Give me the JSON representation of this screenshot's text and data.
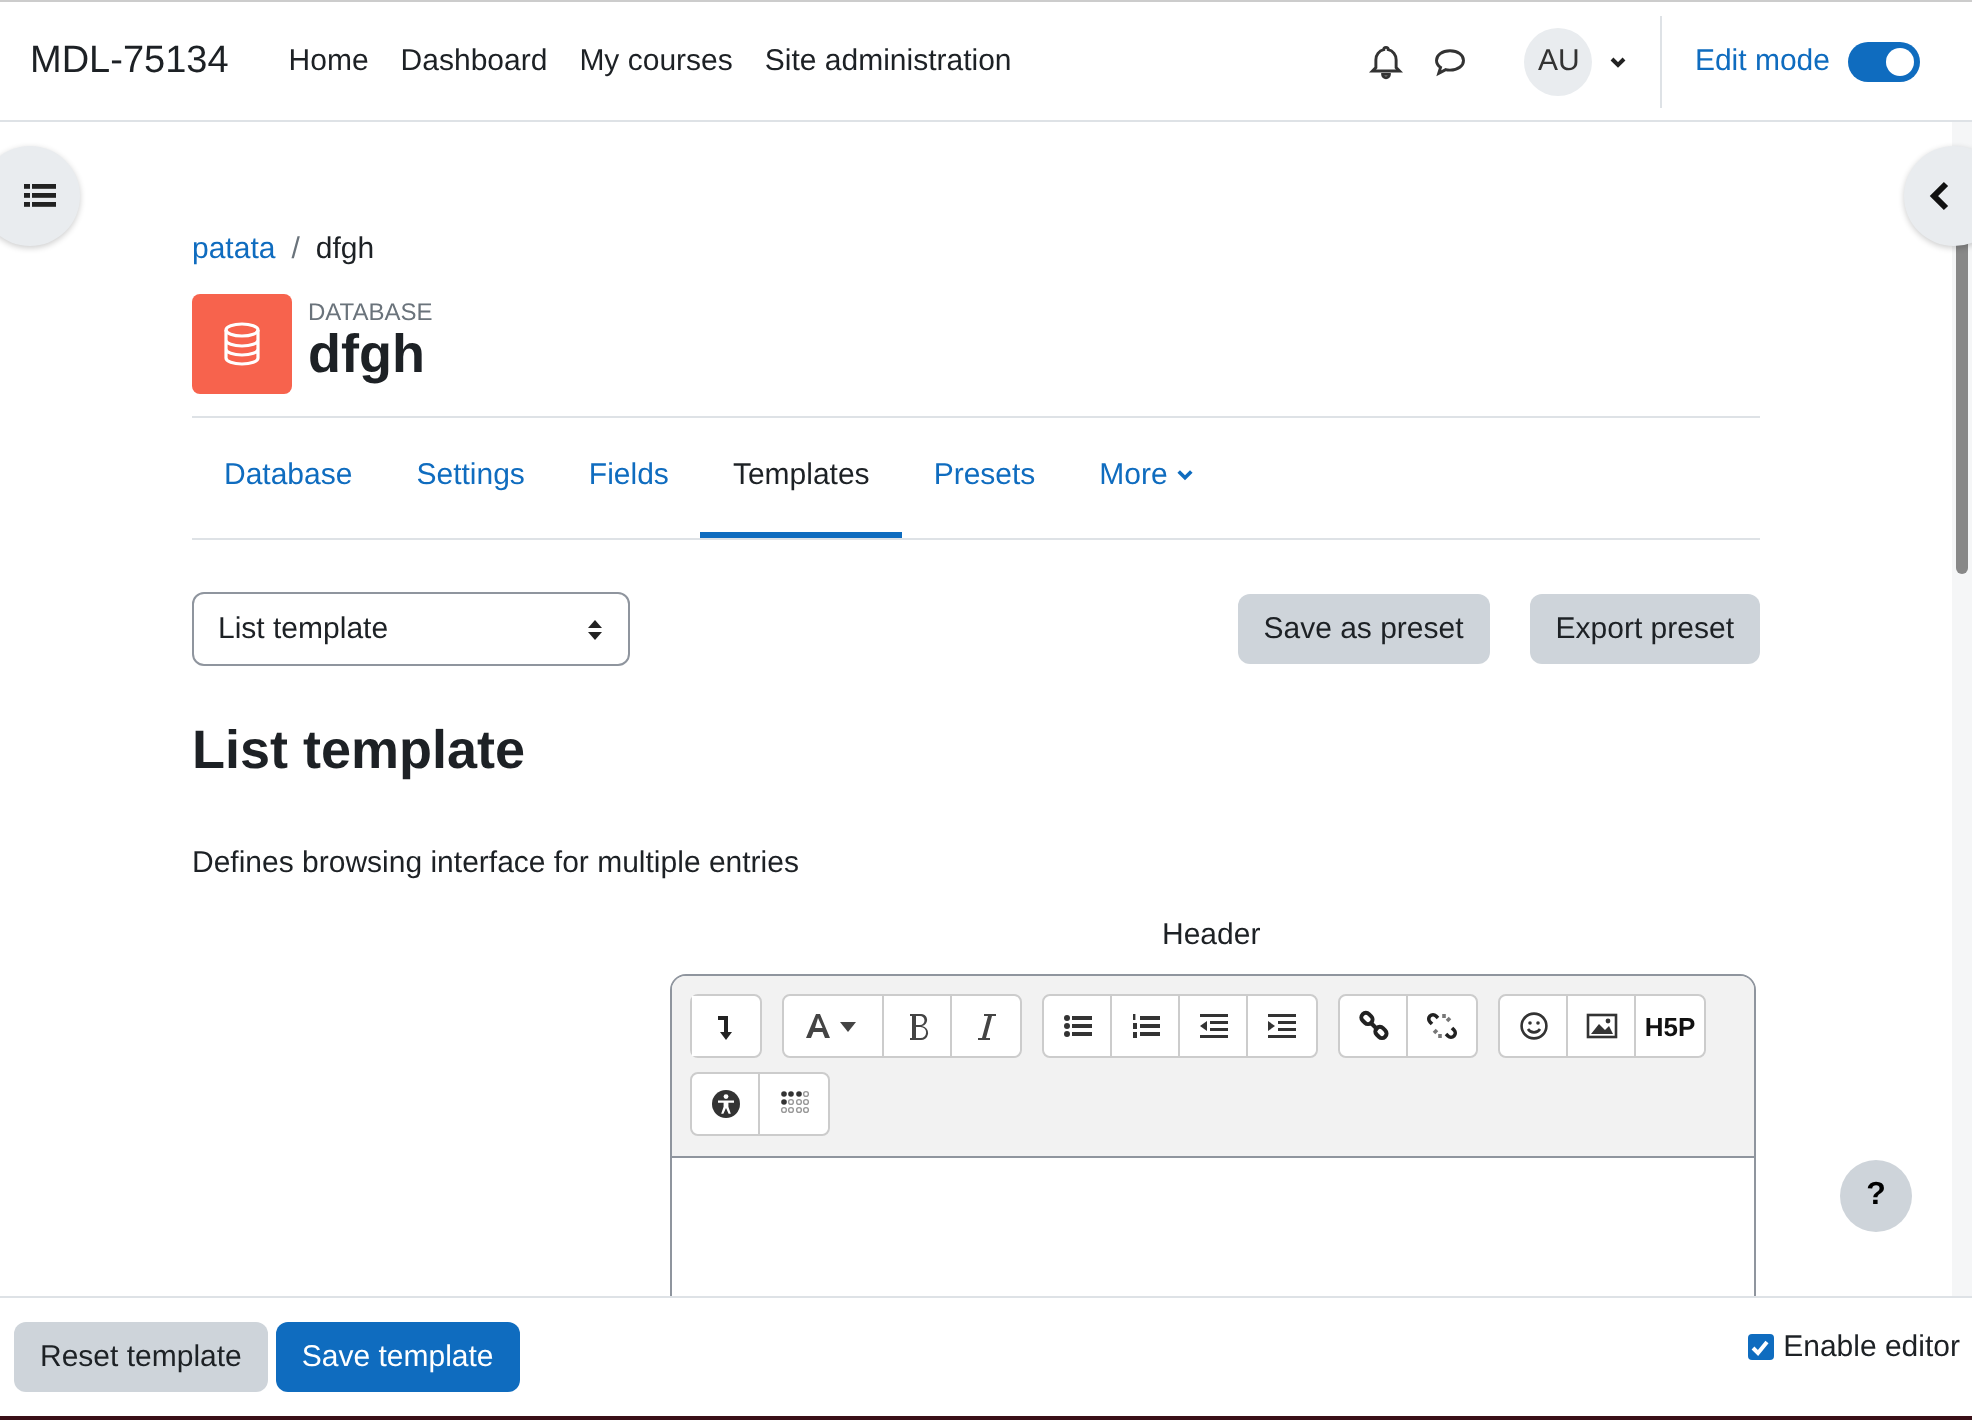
{
  "navbar": {
    "site_name": "MDL-75134",
    "links": [
      {
        "label": "Home"
      },
      {
        "label": "Dashboard"
      },
      {
        "label": "My courses"
      },
      {
        "label": "Site administration"
      }
    ],
    "avatar": "AU",
    "edit_mode": {
      "label": "Edit mode",
      "on": true
    }
  },
  "breadcrumb": {
    "separator": "/",
    "items": [
      {
        "label": "patata",
        "link": true
      },
      {
        "label": "dfgh",
        "link": false
      }
    ]
  },
  "activity": {
    "type": "DATABASE",
    "name": "dfgh"
  },
  "tabs": [
    {
      "label": "Database",
      "selected": false
    },
    {
      "label": "Settings",
      "selected": false
    },
    {
      "label": "Fields",
      "selected": false
    },
    {
      "label": "Templates",
      "selected": true
    },
    {
      "label": "Presets",
      "selected": false
    },
    {
      "label": "More",
      "selected": false,
      "dropdown": true
    }
  ],
  "template_select": {
    "value": "List template"
  },
  "actions": [
    "Save as preset",
    "Export preset"
  ],
  "heading": "List template",
  "description": "Defines browsing interface for multiple entries",
  "editor": {
    "label": "Header",
    "toolbar": [
      [
        {
          "kind": "collapse"
        }
      ],
      [
        {
          "kind": "fontcolor"
        },
        {
          "kind": "bold"
        },
        {
          "kind": "italic"
        }
      ],
      [
        {
          "kind": "bullets"
        },
        {
          "kind": "numbers"
        },
        {
          "kind": "outdent"
        },
        {
          "kind": "indent"
        }
      ],
      [
        {
          "kind": "link"
        },
        {
          "kind": "unlink"
        }
      ],
      [
        {
          "kind": "emoji"
        },
        {
          "kind": "image"
        },
        {
          "kind": "text",
          "label": "H5P"
        }
      ],
      [
        {
          "kind": "accessibility"
        },
        {
          "kind": "braille"
        }
      ]
    ]
  },
  "help": "?",
  "footer": {
    "buttons": [
      {
        "label": "Reset template",
        "primary": false
      },
      {
        "label": "Save template",
        "primary": true
      }
    ],
    "enable_editor": {
      "label": "Enable editor",
      "checked": true
    }
  }
}
